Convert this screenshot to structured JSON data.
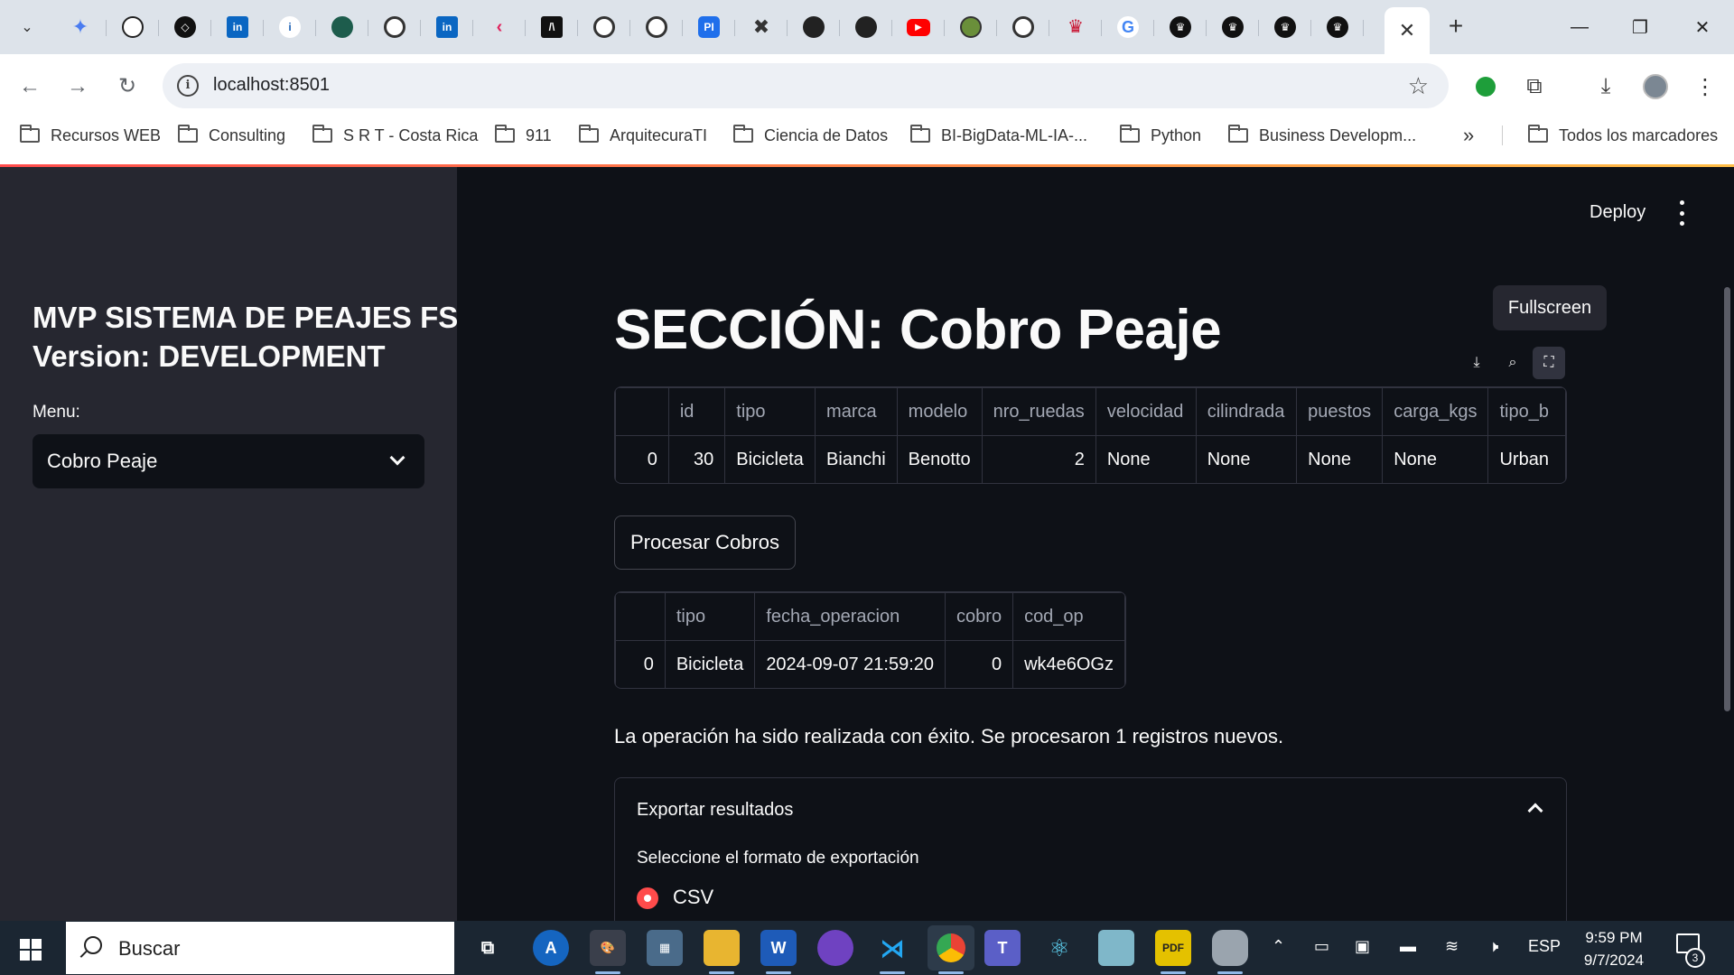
{
  "browser": {
    "tab_favicons": [
      "gemini-icon",
      "openai-icon",
      "codepen-icon",
      "linkedin-icon",
      "info-icon",
      "globe-icon",
      "github-icon",
      "linkedin-icon",
      "vercel-icon",
      "code-icon",
      "openai-icon",
      "github-icon",
      "pi-icon",
      "tools-icon",
      "github-icon",
      "github-icon",
      "youtube-icon",
      "frog-icon",
      "github-icon",
      "crown-icon",
      "google-icon",
      "crown-icon",
      "crown-icon",
      "crown-icon",
      "crown-icon"
    ],
    "url": "localhost:8501",
    "bookmarks": [
      "Recursos WEB",
      "Consulting",
      "S R T - Costa Rica",
      "911",
      "ArquitecuraTI",
      "Ciencia de Datos",
      "BI-BigData-ML-IA-...",
      "Python",
      "Business Developm..."
    ],
    "bookmarks_overflow": "»",
    "all_bookmarks": "Todos los marcadores"
  },
  "sidebar": {
    "title_line1": "MVP SISTEMA DE PEAJES FS",
    "title_line2": "Version: DEVELOPMENT",
    "menu_label": "Menu:",
    "menu_selected": "Cobro Peaje"
  },
  "header": {
    "deploy_label": "Deploy",
    "tooltip": "Fullscreen"
  },
  "main": {
    "title": "SECCIÓN: Cobro Peaje",
    "vehicles_table": {
      "columns": [
        "",
        "id",
        "tipo",
        "marca",
        "modelo",
        "nro_ruedas",
        "velocidad",
        "cilindrada",
        "puestos",
        "carga_kgs",
        "tipo_b"
      ],
      "rows": [
        [
          "0",
          "30",
          "Bicicleta",
          "Bianchi",
          "Benotto",
          "2",
          "None",
          "None",
          "None",
          "None",
          "Urban"
        ]
      ]
    },
    "process_button": "Procesar Cobros",
    "charges_table": {
      "columns": [
        "",
        "tipo",
        "fecha_operacion",
        "cobro",
        "cod_op"
      ],
      "rows": [
        [
          "0",
          "Bicicleta",
          "2024-09-07 21:59:20",
          "0",
          "wk4e6OGz"
        ]
      ]
    },
    "success_message": "La operación ha sido realizada con éxito. Se procesaron 1 registros nuevos.",
    "export": {
      "title": "Exportar resultados",
      "format_label": "Seleccione el formato de exportación",
      "option_selected": "CSV"
    }
  },
  "taskbar": {
    "search_placeholder": "Buscar",
    "language": "ESP",
    "time": "9:59 PM",
    "date": "9/7/2024",
    "notifications": "3"
  },
  "colors": {
    "accent": "#ff4b4b",
    "app_bg": "#0e1117",
    "sidebar_bg": "#262730"
  }
}
